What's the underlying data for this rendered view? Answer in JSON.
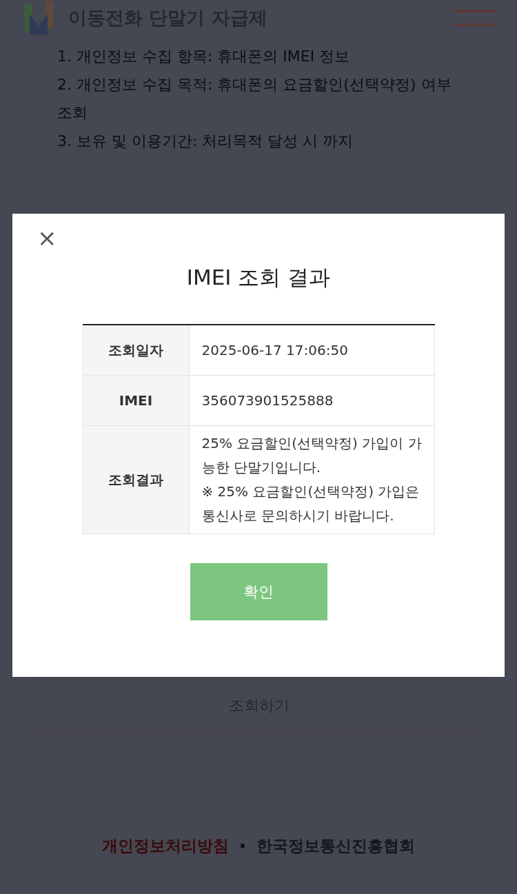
{
  "header": {
    "title": "이동전화 단말기 자급제"
  },
  "consent_items": [
    "1. 개인정보 수집 항목: 휴대폰의 IMEI 정보",
    "2. 개인정보 수집 목적: 휴대폰의 요금할인(선택약정) 여부 조회",
    "3. 보유 및 이용기간: 처리목적 달성 시 까지"
  ],
  "lookup_button": "조회하기",
  "footer": {
    "separator": "·",
    "links": [
      {
        "label": "개인정보처리방침",
        "emphasized": true
      },
      {
        "label": "한국정보통신진흥협회",
        "emphasized": false
      }
    ]
  },
  "modal": {
    "close": "×",
    "title": "IMEI 조회 결과",
    "rows": [
      {
        "label": "조회일자",
        "value": "2025-06-17 17:06:50"
      },
      {
        "label": "IMEI",
        "value": "356073901525888"
      },
      {
        "label": "조회결과",
        "value": "25% 요금할인(선택약정) 가입이 가능한 단말기입니다.\n※ 25% 요금할인(선택약정) 가입은 통신사로 문의하시기 바랍니다."
      }
    ],
    "confirm_button": "확인"
  }
}
